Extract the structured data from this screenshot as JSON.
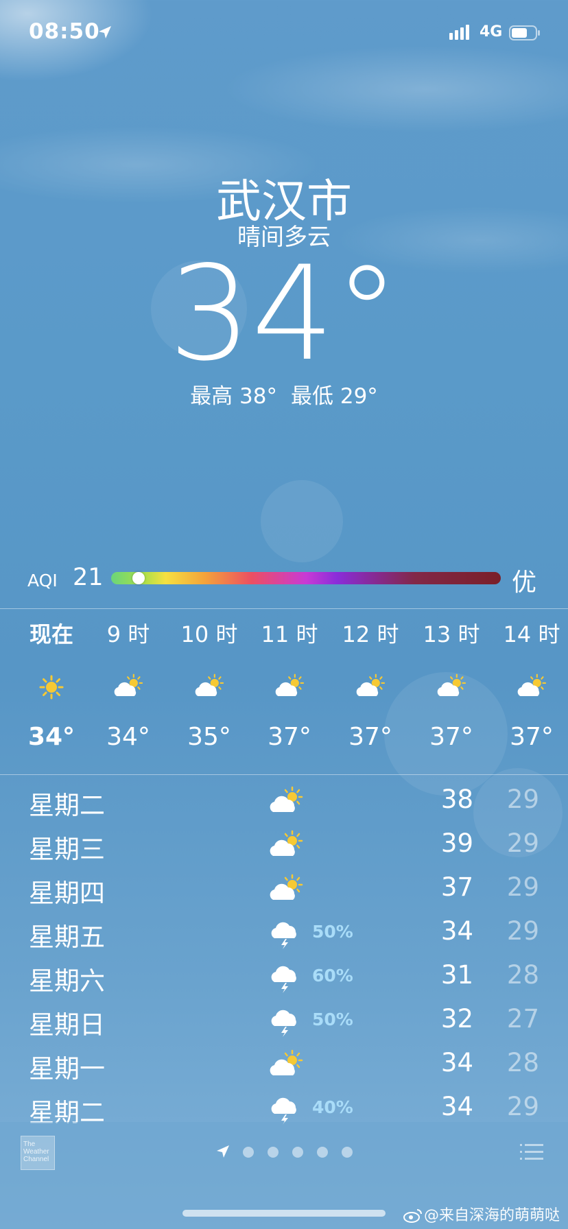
{
  "status_bar": {
    "time": "08:50",
    "network": "4G"
  },
  "location": {
    "city": "武汉市",
    "condition": "晴间多云",
    "temperature": "34°",
    "high": "最高 38°",
    "low": "最低 29°"
  },
  "aqi": {
    "label": "AQI",
    "value": "21",
    "level": "优",
    "fraction": 0.07
  },
  "hourly": [
    {
      "label": "现在",
      "icon": "sun-icon",
      "temp": "34°"
    },
    {
      "label": "9 时",
      "icon": "partly-cloudy-icon",
      "temp": "34°"
    },
    {
      "label": "10 时",
      "icon": "partly-cloudy-icon",
      "temp": "35°"
    },
    {
      "label": "11 时",
      "icon": "partly-cloudy-icon",
      "temp": "37°"
    },
    {
      "label": "12 时",
      "icon": "partly-cloudy-icon",
      "temp": "37°"
    },
    {
      "label": "13 时",
      "icon": "partly-cloudy-icon",
      "temp": "37°"
    },
    {
      "label": "14 时",
      "icon": "partly-cloudy-icon",
      "temp": "37°"
    }
  ],
  "daily": [
    {
      "day": "星期二",
      "icon": "partly-cloudy-icon",
      "precip": "",
      "high": "38",
      "low": "29"
    },
    {
      "day": "星期三",
      "icon": "partly-cloudy-icon",
      "precip": "",
      "high": "39",
      "low": "29"
    },
    {
      "day": "星期四",
      "icon": "partly-cloudy-icon",
      "precip": "",
      "high": "37",
      "low": "29"
    },
    {
      "day": "星期五",
      "icon": "thunderstorm-icon",
      "precip": "50%",
      "high": "34",
      "low": "29"
    },
    {
      "day": "星期六",
      "icon": "thunderstorm-icon",
      "precip": "60%",
      "high": "31",
      "low": "28"
    },
    {
      "day": "星期日",
      "icon": "thunderstorm-icon",
      "precip": "50%",
      "high": "32",
      "low": "27"
    },
    {
      "day": "星期一",
      "icon": "partly-cloudy-icon",
      "precip": "",
      "high": "34",
      "low": "28"
    },
    {
      "day": "星期二",
      "icon": "thunderstorm-icon",
      "precip": "40%",
      "high": "34",
      "low": "29"
    }
  ],
  "footer": {
    "logo_text": "The Weather Channel",
    "watermark": "@来自深海的萌萌哒",
    "page_count": 5
  }
}
